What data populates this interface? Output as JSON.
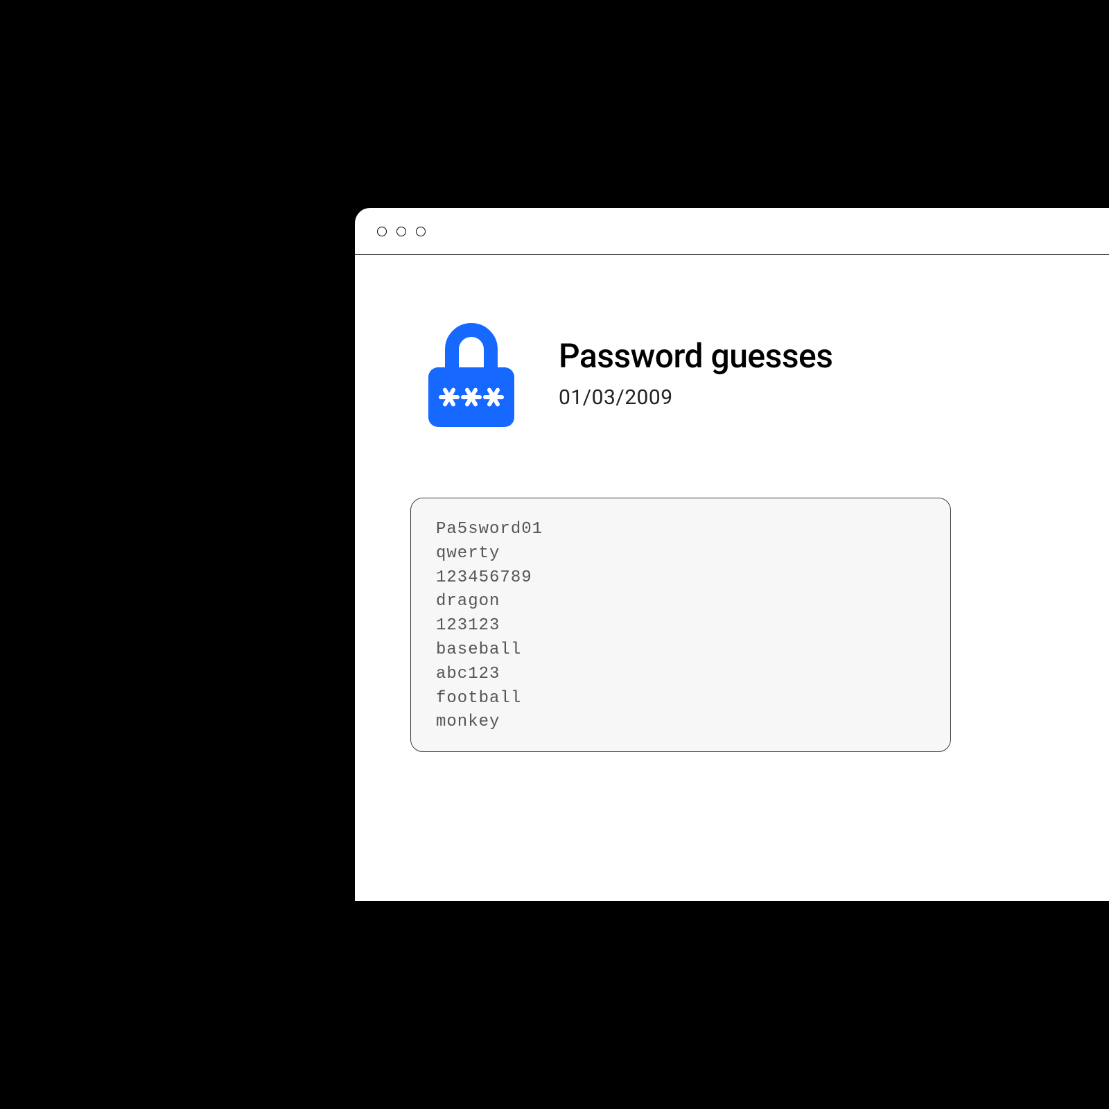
{
  "header": {
    "title": "Password guesses",
    "date": "01/03/2009"
  },
  "colors": {
    "accent": "#1668ff"
  },
  "passwords": [
    "Pa5sword01",
    "qwerty",
    "123456789",
    "dragon",
    "123123",
    "baseball",
    "abc123",
    "football",
    "monkey"
  ]
}
